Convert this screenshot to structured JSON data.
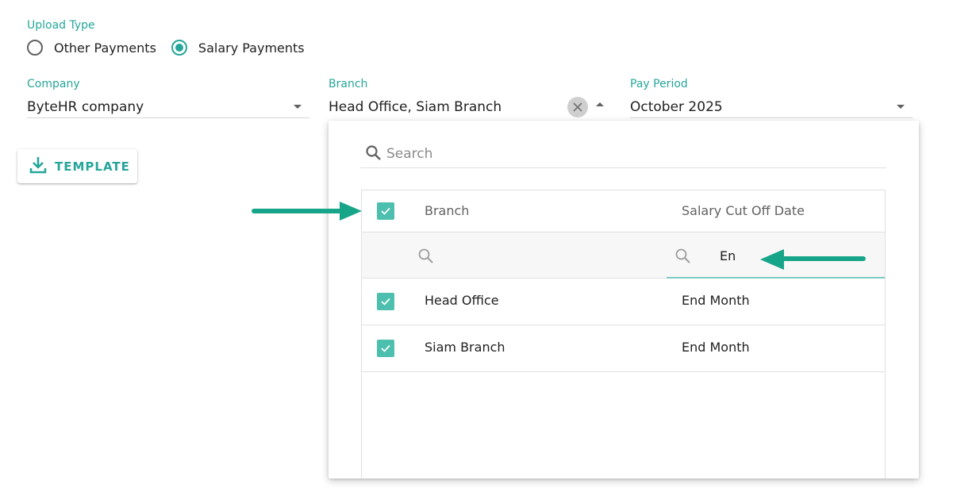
{
  "upload_type": {
    "label": "Upload Type",
    "options": [
      {
        "label": "Other Payments",
        "selected": false
      },
      {
        "label": "Salary Payments",
        "selected": true
      }
    ]
  },
  "fields": {
    "company": {
      "label": "Company",
      "value": "ByteHR company"
    },
    "branch": {
      "label": "Branch",
      "value": "Head Office, Siam Branch"
    },
    "pay_period": {
      "label": "Pay Period",
      "value": "October 2025"
    }
  },
  "template_button": {
    "label": "TEMPLATE",
    "icon": "download-icon"
  },
  "branch_dropdown": {
    "search_placeholder": "Search",
    "columns": [
      "Branch",
      "Salary Cut Off Date"
    ],
    "filters": {
      "branch": "",
      "salary_cut_off_date": "En"
    },
    "rows": [
      {
        "branch": "Head Office",
        "salary_cut_off_date": "End Month",
        "checked": true
      },
      {
        "branch": "Siam Branch",
        "salary_cut_off_date": "End Month",
        "checked": true
      }
    ],
    "select_all_checked": true
  },
  "colors": {
    "accent": "#26a69a",
    "checkbox": "#4dbfae",
    "annotation_arrow": "#17a589"
  }
}
